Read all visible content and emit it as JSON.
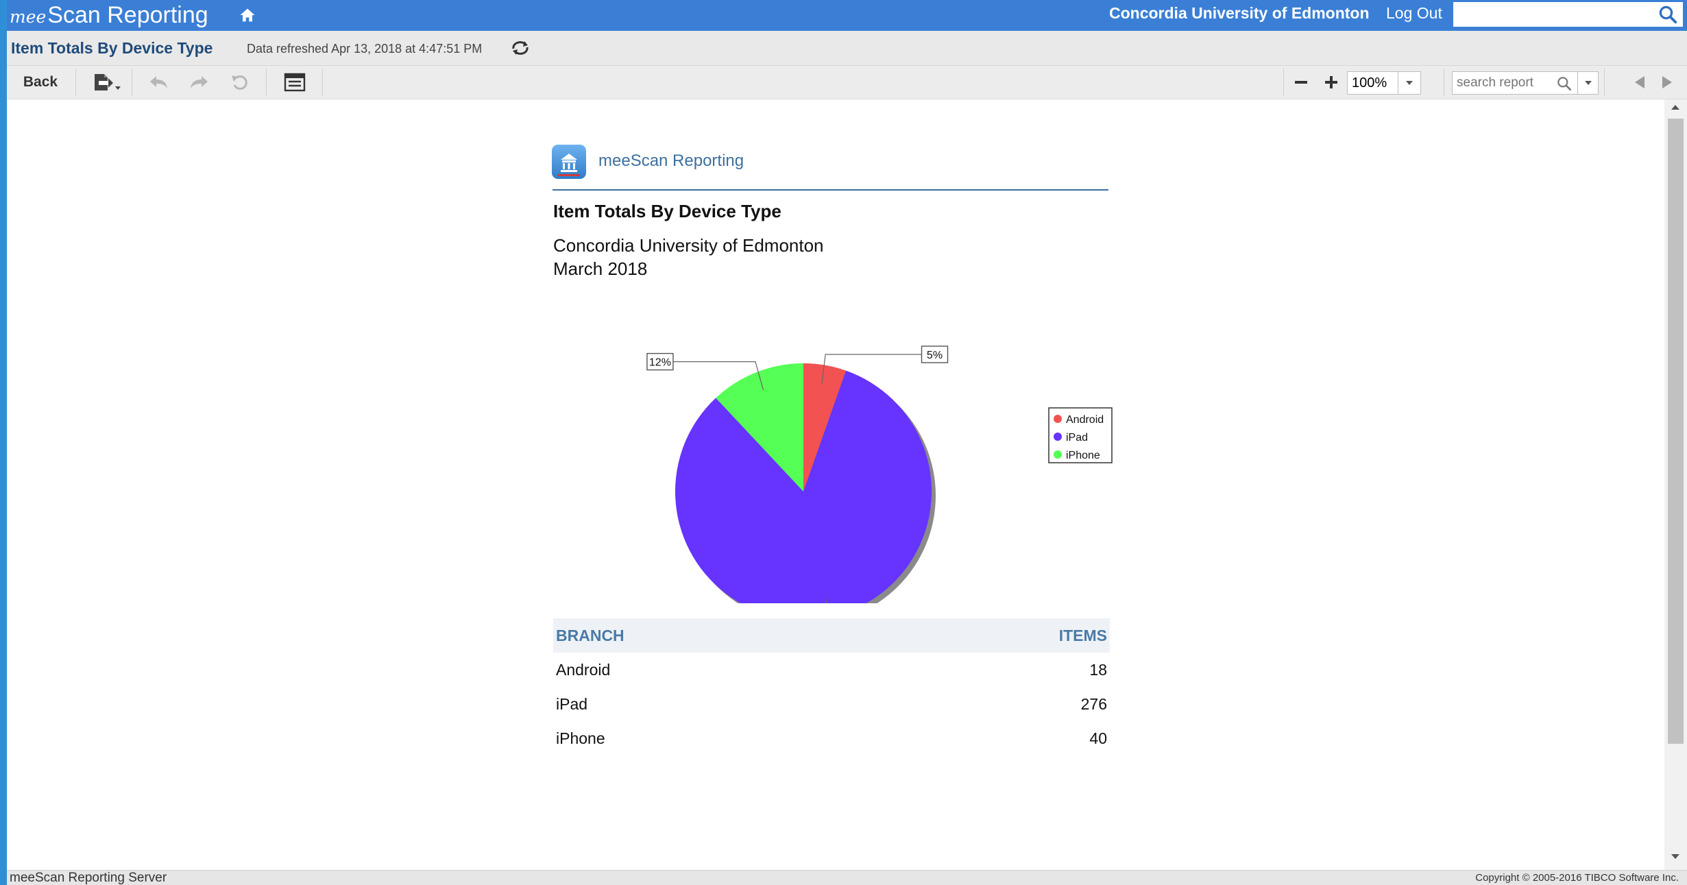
{
  "app": {
    "brand_prefix": "mee",
    "brand_rest": "Scan Reporting",
    "org_name": "Concordia University of Edmonton",
    "logout_label": "Log Out",
    "search_value": ""
  },
  "titlebar": {
    "report_title": "Item Totals By Device Type",
    "refreshed": "Data refreshed Apr 13, 2018 at 4:47:51 PM"
  },
  "toolbar": {
    "back_label": "Back",
    "zoom_value": "100%",
    "search_placeholder": "search report"
  },
  "report": {
    "brand": "meeScan Reporting",
    "title": "Item Totals By Device Type",
    "org": "Concordia University of Edmonton",
    "period": "March 2018",
    "table": {
      "headers": [
        "BRANCH",
        "ITEMS"
      ],
      "rows": [
        {
          "branch": "Android",
          "items": "18"
        },
        {
          "branch": "iPad",
          "items": "276"
        },
        {
          "branch": "iPhone",
          "items": "40"
        }
      ]
    }
  },
  "chart_data": {
    "type": "pie",
    "categories": [
      "Android",
      "iPad",
      "iPhone"
    ],
    "values": [
      18,
      276,
      40
    ],
    "labels": [
      "5%",
      "83%",
      "12%"
    ],
    "colors": [
      "#f25252",
      "#6633ff",
      "#55ff55"
    ],
    "title": "",
    "legend": "right"
  },
  "status": {
    "left": "meeScan Reporting Server",
    "right": "Copyright © 2005-2016 TIBCO Software Inc."
  }
}
